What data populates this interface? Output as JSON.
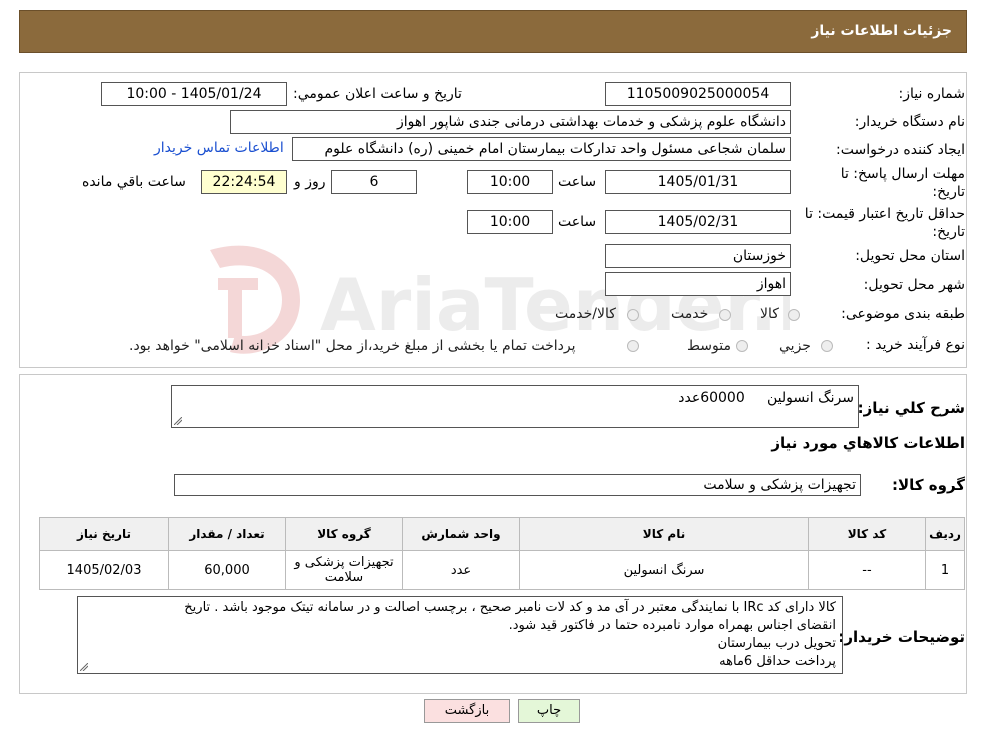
{
  "header": {
    "title": "جزئیات اطلاعات نیاز"
  },
  "form": {
    "need_number_label": "شماره نیاز:",
    "need_number": "1105009025000054",
    "announce_label": "تاریخ و ساعت اعلان عمومي:",
    "announce_value": "1405/01/24 - 10:00",
    "buyer_org_label": "نام دستگاه خریدار:",
    "buyer_org": "دانشگاه علوم پزشکی و خدمات بهداشتی درمانی جندی شاپور اهواز",
    "creator_label": "ایجاد کننده درخواست:",
    "creator": "سلمان شجاعی مسئول واحد تدارکات بیمارستان امام خمینی (ره) دانشگاه علوم",
    "contact_link": "اطلاعات تماس خریدار",
    "reply_deadline_label": "مهلت ارسال پاسخ: تا تاریخ:",
    "reply_date": "1405/01/31",
    "time_label": "ساعت",
    "reply_time": "10:00",
    "days_value": "6",
    "days_label": "روز و",
    "remaining_time": "22:24:54",
    "remaining_label": "ساعت باقي مانده",
    "price_validity_label": "حداقل تاریخ اعتبار قیمت: تا تاریخ:",
    "price_date": "1405/02/31",
    "price_time": "10:00",
    "province_label": "استان محل تحویل:",
    "province": "خوزستان",
    "city_label": "شهر محل تحویل:",
    "city": "اهواز",
    "category_label": "طبقه بندی موضوعی:",
    "category_options": [
      "کالا",
      "خدمت",
      "کالا/خدمت"
    ],
    "process_label": "نوع فرآیند خرید :",
    "process_options": [
      "جزیي",
      "متوسط"
    ],
    "process_note": "پرداخت تمام یا بخشی از مبلغ خرید،از محل \"اسناد خزانه اسلامی\" خواهد بود."
  },
  "details": {
    "summary_label": "شرح کلي نیاز:",
    "summary": "سرنگ انسولین     60000عدد",
    "goods_info_title": "اطلاعات کالاهاي مورد نیاز",
    "goods_group_label": "گروه کالا:",
    "goods_group": "تجهیزات پزشکی و سلامت",
    "table": {
      "headers": [
        "ردیف",
        "کد کالا",
        "نام کالا",
        "واحد شمارش",
        "گروه کالا",
        "تعداد / مقدار",
        "تاریخ نیاز"
      ],
      "rows": [
        [
          "1",
          "--",
          "سرنگ انسولین",
          "عدد",
          "تجهیزات پزشکی و سلامت",
          "60,000",
          "1405/02/03"
        ]
      ]
    },
    "buyer_notes_label": "توضیحات خریدار:",
    "buyer_notes": [
      "کالا دارای کد IRc با نمایندگی معتبر در آی مد و کد لات نامبر صحیح ، برچسب اصالت و در سامانه تیتک موجود باشد . تاریخ",
      "انقضای اجناس بهمراه موارد نامبرده حتما در فاکتور قید شود.",
      "تحویل درب بیمارستان",
      "پرداخت حداقل 6ماهه"
    ]
  },
  "buttons": {
    "print": "چاپ",
    "back": "بازگشت"
  },
  "watermark": {
    "text": "AriaTender.neT"
  },
  "colors": {
    "header_bg": "#8b6a3c",
    "link": "#1a4fd0",
    "timer_bg": "#ffffd0",
    "print_bg": "#e4f7d8",
    "back_bg": "#fbe0e0"
  }
}
